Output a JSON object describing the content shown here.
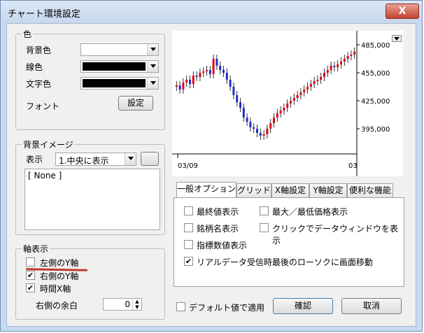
{
  "window": {
    "title": "チャート環境設定",
    "close_label": "X"
  },
  "color": {
    "group_label": "色",
    "background": {
      "label": "背景色",
      "value": "#ffffff"
    },
    "line": {
      "label": "線色",
      "value": "#000000"
    },
    "text": {
      "label": "文字色",
      "value": "#000000"
    },
    "font": {
      "label": "フォント",
      "button": "設定"
    }
  },
  "bg_image": {
    "group_label": "背景イメージ",
    "display_label": "表示",
    "display_value": "1.中央に表示",
    "list_items": [
      "[ None ]"
    ]
  },
  "axis": {
    "group_label": "軸表示",
    "left_y": {
      "label": "左側のY軸",
      "checked": false
    },
    "right_y": {
      "label": "右側のY軸",
      "checked": true
    },
    "time_x": {
      "label": "時間X軸",
      "checked": true
    },
    "margin_label": "右側の余白",
    "margin_value": "0"
  },
  "chart_data": {
    "type": "candlestick",
    "x_labels": [
      "03/09",
      "03"
    ],
    "y_ticks": [
      "485,000",
      "455,000",
      "425,000",
      "395,000"
    ],
    "colors": {
      "up": "#e0001a",
      "down": "#1f2fd0"
    }
  },
  "tabs": [
    "一般オプション",
    "グリッド",
    "X軸設定",
    "Y軸設定",
    "便利な機能"
  ],
  "options": [
    {
      "label": "最終値表示",
      "checked": false
    },
    {
      "label": "最大／最低価格表示",
      "checked": false
    },
    {
      "label": "銘柄名表示",
      "checked": false
    },
    {
      "label": "クリックでデータウィンドウを表示",
      "checked": false
    },
    {
      "label": "指標数値表示",
      "checked": false
    },
    {
      "label": "リアルデータ受信時最後のローソクに画面移動",
      "checked": true
    }
  ],
  "footer": {
    "default_label": "デフォルト値で適用",
    "ok": "確認",
    "cancel": "取消"
  }
}
